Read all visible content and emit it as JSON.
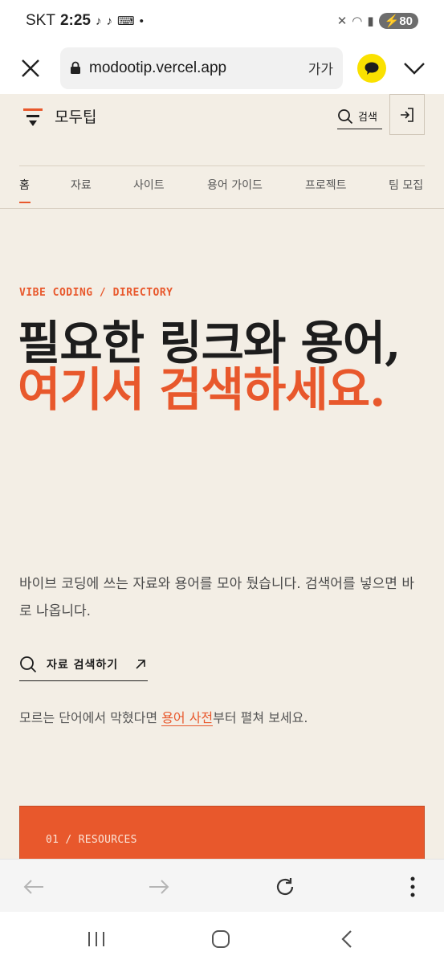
{
  "status_bar": {
    "carrier": "SKT",
    "time": "2:25",
    "battery": "80"
  },
  "browser": {
    "url": "modootip.vercel.app",
    "text_size_label": "가가"
  },
  "site": {
    "name": "모두팁",
    "search_label": "검색",
    "accent_color": "#e8582c",
    "background_color": "#f3eee5"
  },
  "nav": {
    "items": [
      {
        "label": "홈",
        "active": true
      },
      {
        "label": "자료",
        "active": false
      },
      {
        "label": "사이트",
        "active": false
      },
      {
        "label": "용어 가이드",
        "active": false
      },
      {
        "label": "프로젝트",
        "active": false
      },
      {
        "label": "팀 모집",
        "active": false
      }
    ]
  },
  "hero": {
    "eyebrow": "VIBE CODING / DIRECTORY",
    "headline_line1": "필요한 링크와 용어,",
    "headline_line2": "여기서 검색하세요.",
    "description": "바이브 코딩에 쓰는 자료와 용어를 모아 뒀습니다. 검색어를 넣으면 바로 나옵니다.",
    "cta_label": "자료 검색하기",
    "hint_before": "모르는 단어에서 막혔다면 ",
    "hint_link": "용어 사전",
    "hint_after": "부터 펼쳐 보세요."
  },
  "section_card": {
    "label": "01 / RESOURCES"
  }
}
